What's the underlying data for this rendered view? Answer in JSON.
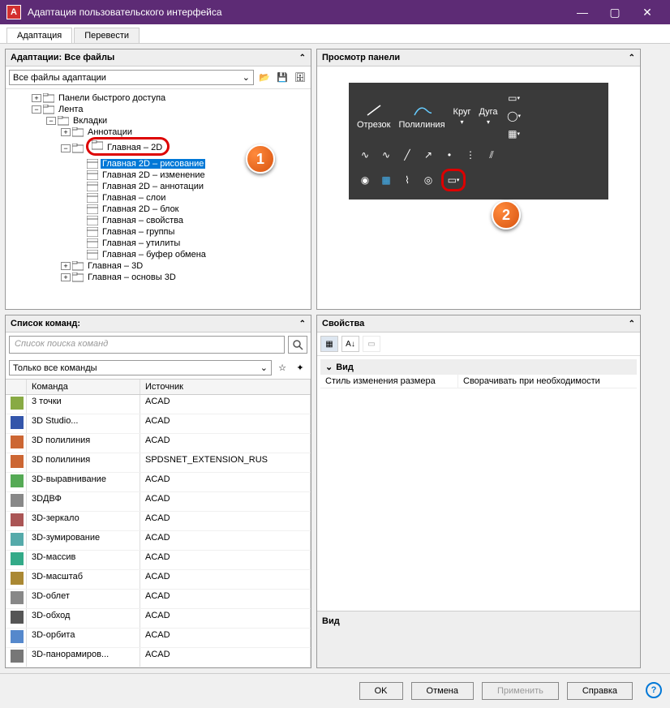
{
  "window": {
    "title": "Адаптация пользовательского интерфейса"
  },
  "tabs": {
    "t1": "Адаптация",
    "t2": "Перевести"
  },
  "panels": {
    "adaptations": {
      "title": "Адаптации: Все файлы",
      "dropdown": "Все файлы адаптации"
    },
    "commands": {
      "title": "Список команд:",
      "search_placeholder": "Список поиска команд",
      "filter": "Только все команды",
      "col_cmd": "Команда",
      "col_src": "Источник"
    },
    "preview": {
      "title": "Просмотр панели"
    },
    "props": {
      "title": "Свойства",
      "cat": "Вид",
      "row_k": "Стиль изменения размера",
      "row_v": "Сворачивать при необходимости",
      "footer": "Вид"
    }
  },
  "tree": [
    {
      "level": 1,
      "exp": "+",
      "icon": "folder",
      "label": "Панели быстрого доступа"
    },
    {
      "level": 1,
      "exp": "-",
      "icon": "folder",
      "label": "Лента"
    },
    {
      "level": 2,
      "exp": "-",
      "icon": "folder",
      "label": "Вкладки"
    },
    {
      "level": 3,
      "exp": "+",
      "icon": "folder",
      "label": "Аннотации"
    },
    {
      "level": 3,
      "exp": "-",
      "icon": "folder",
      "label": "Главная – 2D",
      "outlined": true
    },
    {
      "level": 4,
      "exp": "",
      "icon": "panel",
      "label": "Главная 2D – рисование",
      "selected": true
    },
    {
      "level": 4,
      "exp": "",
      "icon": "panel",
      "label": "Главная 2D – изменение"
    },
    {
      "level": 4,
      "exp": "",
      "icon": "panel",
      "label": "Главная 2D – аннотации"
    },
    {
      "level": 4,
      "exp": "",
      "icon": "panel",
      "label": "Главная – слои"
    },
    {
      "level": 4,
      "exp": "",
      "icon": "panel",
      "label": "Главная 2D – блок"
    },
    {
      "level": 4,
      "exp": "",
      "icon": "panel",
      "label": "Главная – свойства"
    },
    {
      "level": 4,
      "exp": "",
      "icon": "panel",
      "label": "Главная – группы"
    },
    {
      "level": 4,
      "exp": "",
      "icon": "panel",
      "label": "Главная – утилиты"
    },
    {
      "level": 4,
      "exp": "",
      "icon": "panel",
      "label": "Главная – буфер обмена"
    },
    {
      "level": 3,
      "exp": "+",
      "icon": "folder",
      "label": "Главная – 3D"
    },
    {
      "level": 3,
      "exp": "+",
      "icon": "folder",
      "label": "Главная – основы 3D"
    }
  ],
  "tb": {
    "t1": "Отрезок",
    "t2": "Полилиния",
    "t3": "Круг",
    "t4": "Дуга"
  },
  "commands_list": [
    {
      "name": "3 точки",
      "src": "ACAD",
      "c": "#8a4"
    },
    {
      "name": "3D Studio...",
      "src": "ACAD",
      "c": "#35a"
    },
    {
      "name": "3D полилиния",
      "src": "ACAD",
      "c": "#c63"
    },
    {
      "name": "3D полилиния",
      "src": "SPDSNET_EXTENSION_RUS",
      "c": "#c63"
    },
    {
      "name": "3D-выравнивание",
      "src": "ACAD",
      "c": "#5a5"
    },
    {
      "name": "3DДВФ",
      "src": "ACAD",
      "c": "#888"
    },
    {
      "name": "3D-зеркало",
      "src": "ACAD",
      "c": "#a55"
    },
    {
      "name": "3D-зумирование",
      "src": "ACAD",
      "c": "#5aa"
    },
    {
      "name": "3D-массив",
      "src": "ACAD",
      "c": "#3a8"
    },
    {
      "name": "3D-масштаб",
      "src": "ACAD",
      "c": "#a83"
    },
    {
      "name": "3D-облет",
      "src": "ACAD",
      "c": "#888"
    },
    {
      "name": "3D-обход",
      "src": "ACAD",
      "c": "#555"
    },
    {
      "name": "3D-орбита",
      "src": "ACAD",
      "c": "#58c"
    },
    {
      "name": "3D-панорамиров...",
      "src": "ACAD",
      "c": "#777"
    }
  ],
  "callouts": {
    "c1": "1",
    "c2": "2"
  },
  "footer": {
    "ok": "OK",
    "cancel": "Отмена",
    "apply": "Применить",
    "help": "Справка"
  }
}
